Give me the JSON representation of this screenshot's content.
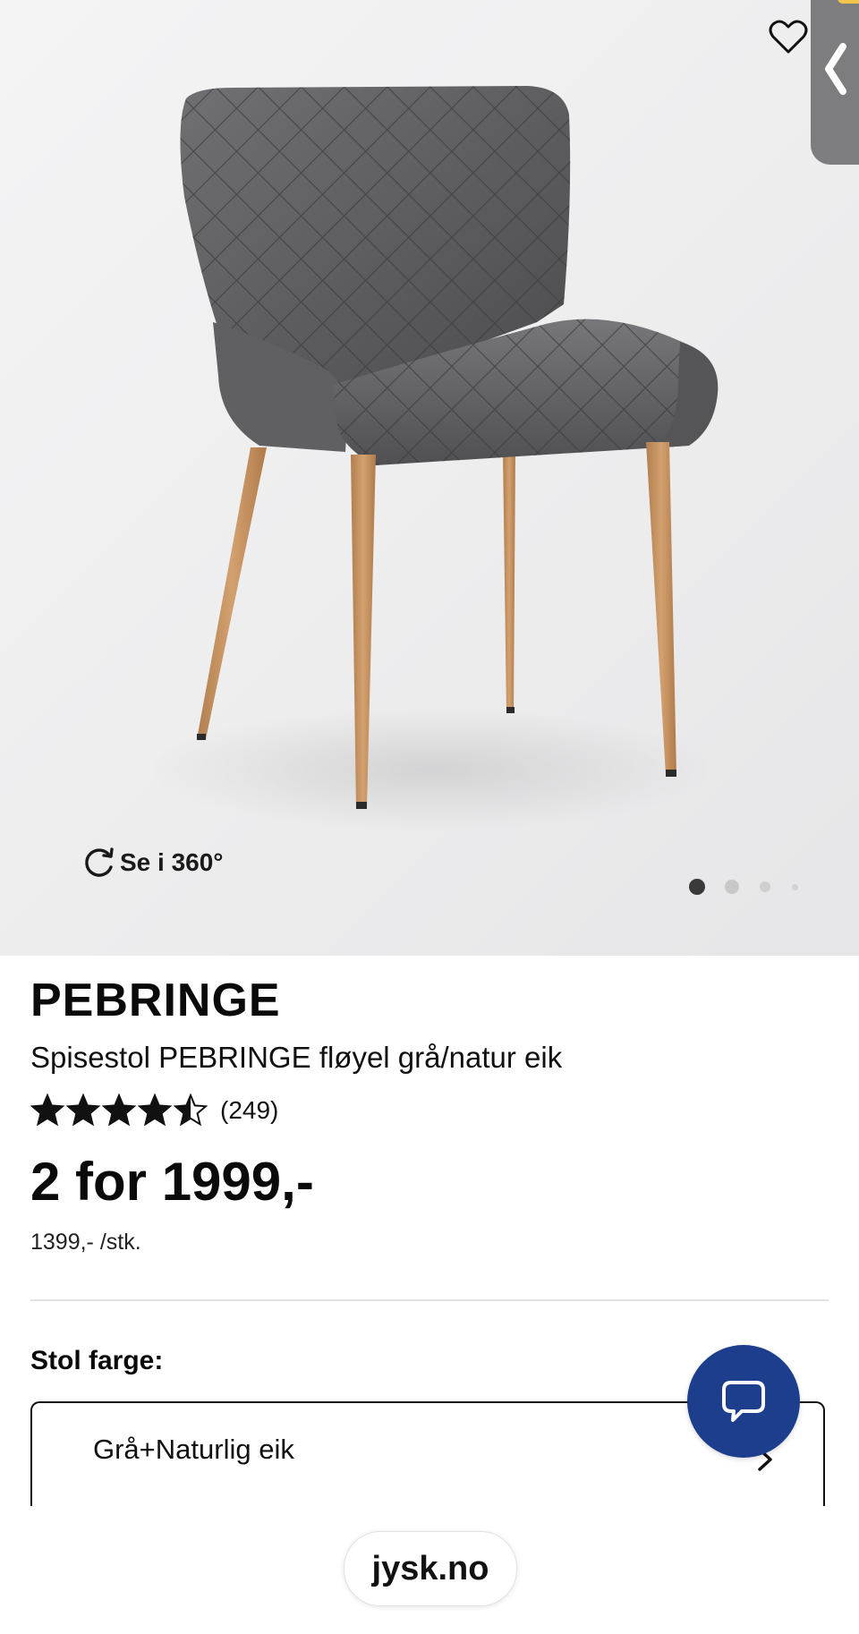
{
  "gallery": {
    "view360_label": "Se i 360°",
    "image_count": 4,
    "active_image": 1
  },
  "product": {
    "brand": "PEBRINGE",
    "subtitle": "Spisestol PEBRINGE fløyel grå/natur eik",
    "rating": {
      "stars": 4.5,
      "max": 5,
      "count_label": "(249)"
    },
    "price": "2 for 1999,-",
    "unit_price": "1399,- /stk."
  },
  "variant": {
    "label": "Stol farge:",
    "selected": "Grå+Naturlig eik"
  },
  "browser": {
    "url": "jysk.no"
  },
  "icons": {
    "favorite": "heart-outline-icon",
    "side_tab": "chevron-left-icon",
    "view360": "rotate-360-icon",
    "chat": "chat-bubble-icon",
    "select": "chevron-right-icon"
  },
  "colors": {
    "chat_button": "#1d3e8c",
    "side_tab": "#7d7d7f",
    "upholstery": "#5e5e60",
    "legs": "#c99562"
  }
}
